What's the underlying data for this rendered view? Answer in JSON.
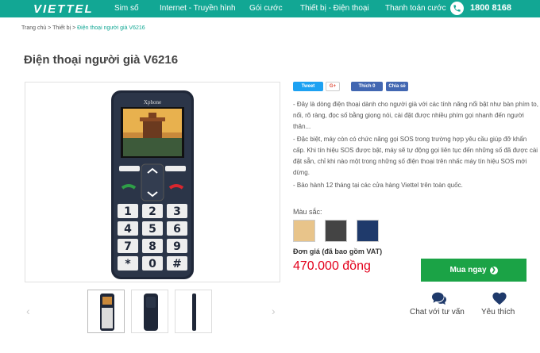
{
  "header": {
    "logo": "VIETTEL",
    "nav": [
      "Sim số",
      "Internet - Truyền hình",
      "Gói cước",
      "Thiết bị - Điện thoại",
      "Thanh toán cước"
    ],
    "hotline": "1800 8168"
  },
  "breadcrumb": {
    "home": "Trang chủ",
    "sep": ">",
    "category": "Thiết bị",
    "current": "Điện thoại người già V6216"
  },
  "product": {
    "title": "Điện thoại người già V6216",
    "brand": "Xphone",
    "keypad": [
      "1",
      "2",
      "3",
      "4",
      "5",
      "6",
      "7",
      "8",
      "9",
      "*",
      "0",
      "#"
    ],
    "description": [
      "- Đây là dòng điện thoại dành cho người già với các tính năng nổi bật như bàn phím to, nổi, rõ ràng, đọc số bằng giọng nói, cài đặt được nhiều phím gọi nhanh đến người thân...",
      "- Đặc biệt, máy còn có chức năng gọi SOS trong trường hợp yêu cầu giúp đỡ khẩn cấp. Khi tín hiệu SOS được bật, máy sẽ tự động gọi liên tục đến những số đã được cài đặt sẵn, chỉ khi nào một trong những số điện thoại trên nhấc máy tín hiệu SOS mới dừng.",
      "- Bảo hành 12 tháng tại các cửa hàng Viettel trên toàn quốc."
    ],
    "color_label": "Màu sắc:",
    "colors": [
      "#e8c48a",
      "#444444",
      "#1f3a6b"
    ],
    "price_label": "Đơn giá (đã bao gồm VAT)",
    "price": "470.000 đồng"
  },
  "share": {
    "tweet": "Tweet",
    "gplus": "G+",
    "like": "Thích 0",
    "share": "Chia sẻ"
  },
  "actions": {
    "buy": "Mua ngay",
    "chat": "Chat với tư vấn",
    "like": "Yêu thích"
  },
  "colors": {
    "brand": "#12a794",
    "buy": "#1ba346",
    "price": "#e3001b"
  }
}
